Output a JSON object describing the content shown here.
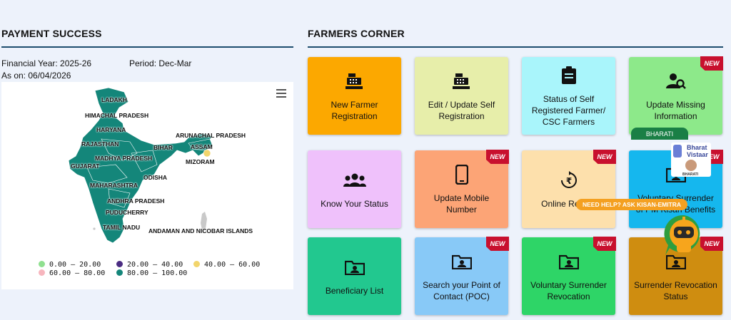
{
  "payment": {
    "title": "PAYMENT SUCCESS",
    "financial_year": "Financial Year: 2025-26",
    "period": "Period: Dec-Mar",
    "as_on": "As on: 06/04/2026",
    "map_labels": {
      "ladakh": "LADAKH",
      "himachal": "HIMACHAL PRADESH",
      "haryana": "HARYANA",
      "rajasthan": "RAJASTHAN",
      "madhya": "MADHYA PRADESH",
      "gujarat": "GUJARAT",
      "maharashtra": "MAHARASHTRA",
      "andhra": "ANDHRA PRADESH",
      "puducherry": "PUDUCHERRY",
      "tamil": "TAMIL NADU",
      "odisha": "ODISHA",
      "bihar": "BIHAR",
      "arunachal": "ARUNACHAL PRADESH",
      "assam": "ASSAM",
      "mizoram": "MIZORAM",
      "andaman": "ANDAMAN AND NICOBAR ISLANDS"
    },
    "legend": [
      {
        "label": "0.00 – 20.00",
        "color": "#90e090"
      },
      {
        "label": "20.00 – 40.00",
        "color": "#4b2c82"
      },
      {
        "label": "40.00 – 60.00",
        "color": "#f2d56c"
      },
      {
        "label": "60.00 – 80.00",
        "color": "#f7b6be"
      },
      {
        "label": "80.00 – 100.00",
        "color": "#14867a"
      }
    ]
  },
  "farmers": {
    "title": "FARMERS CORNER",
    "new_label": "NEW",
    "cards": [
      {
        "label": "New Farmer Registration",
        "color": "#fca800",
        "icon": "cash-register-icon",
        "new": false
      },
      {
        "label": "Edit / Update Self Registration",
        "color": "#e7eeaa",
        "icon": "cash-register-icon",
        "new": false
      },
      {
        "label": "Status of Self Registered Farmer/ CSC Farmers",
        "color": "#a9f5fb",
        "icon": "clipboard-icon",
        "new": false
      },
      {
        "label": "Update Missing Information",
        "color": "#8de98a",
        "icon": "user-search-icon",
        "new": true
      },
      {
        "label": "Know Your Status",
        "color": "#efc1fb",
        "icon": "group-icon",
        "new": false
      },
      {
        "label": "Update Mobile Number",
        "color": "#fca476",
        "icon": "mobile-icon",
        "new": true
      },
      {
        "label": "Online Refund",
        "color": "#fde0ac",
        "icon": "rupee-refund-icon",
        "new": true
      },
      {
        "label": "Voluntary Surrender of PM Kisan Benefits",
        "color": "#15b7ee",
        "icon": "folder-user-icon",
        "new": true
      },
      {
        "label": "Beneficiary List",
        "color": "#22c88f",
        "icon": "folder-user-icon",
        "new": false
      },
      {
        "label": "Search your Point of Contact (POC)",
        "color": "#88c9f7",
        "icon": "folder-user-icon",
        "new": true
      },
      {
        "label": "Voluntary Surrender Revocation",
        "color": "#2ed567",
        "icon": "folder-user-icon",
        "new": true
      },
      {
        "label": "Surrender Revocation Status",
        "color": "#cf8d10",
        "icon": "folder-user-icon",
        "new": true
      }
    ]
  },
  "widgets": {
    "bharati_tag": "BHARATI",
    "bharat_vistaar_line1": "Bharat",
    "bharat_vistaar_line2": "Vistaar",
    "bharati_small": "BHARATI",
    "help_text": "NEED HELP? ASK KISAN-EMITRA"
  }
}
